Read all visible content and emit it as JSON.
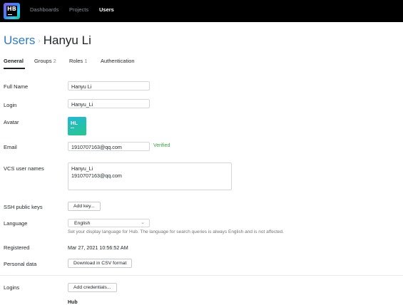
{
  "header": {
    "logo_text": "HB",
    "nav": [
      "Dashboards",
      "Projects",
      "Users"
    ],
    "active_nav": "Users"
  },
  "breadcrumb": {
    "root": "Users",
    "separator": "›",
    "current": "Hanyu Li"
  },
  "tabs": [
    {
      "label": "General",
      "count": ""
    },
    {
      "label": "Groups",
      "count": "2"
    },
    {
      "label": "Roles",
      "count": "1"
    },
    {
      "label": "Authentication",
      "count": ""
    }
  ],
  "form": {
    "full_name_label": "Full Name",
    "full_name_value": "Hanyu Li",
    "login_label": "Login",
    "login_value": "Hanyu_Li",
    "avatar_label": "Avatar",
    "avatar_initials": "HL",
    "email_label": "Email",
    "email_value": "1910707163@qq.com",
    "email_status": "Verified",
    "vcs_label": "VCS user names",
    "vcs_names": [
      "Hanyu_Li",
      "1910707163@qq.com"
    ],
    "ssh_label": "SSH public keys",
    "ssh_button": "Add key...",
    "language_label": "Language",
    "language_value": "English",
    "language_hint": "Set your display language for Hub. The language for search queries is always English and is not affected.",
    "registered_label": "Registered",
    "registered_value": "Mar 27, 2021 10:56:52 AM",
    "personal_data_label": "Personal data",
    "personal_data_button": "Download in CSV format",
    "logins_label": "Logins",
    "logins_button": "Add credentials...",
    "logins_section": "Hub"
  },
  "colors": {
    "accent": "#2f7bbf",
    "verified": "#3ca041",
    "topbar": "#000000"
  },
  "icons": {
    "language_select": "chevron-down-icon"
  }
}
